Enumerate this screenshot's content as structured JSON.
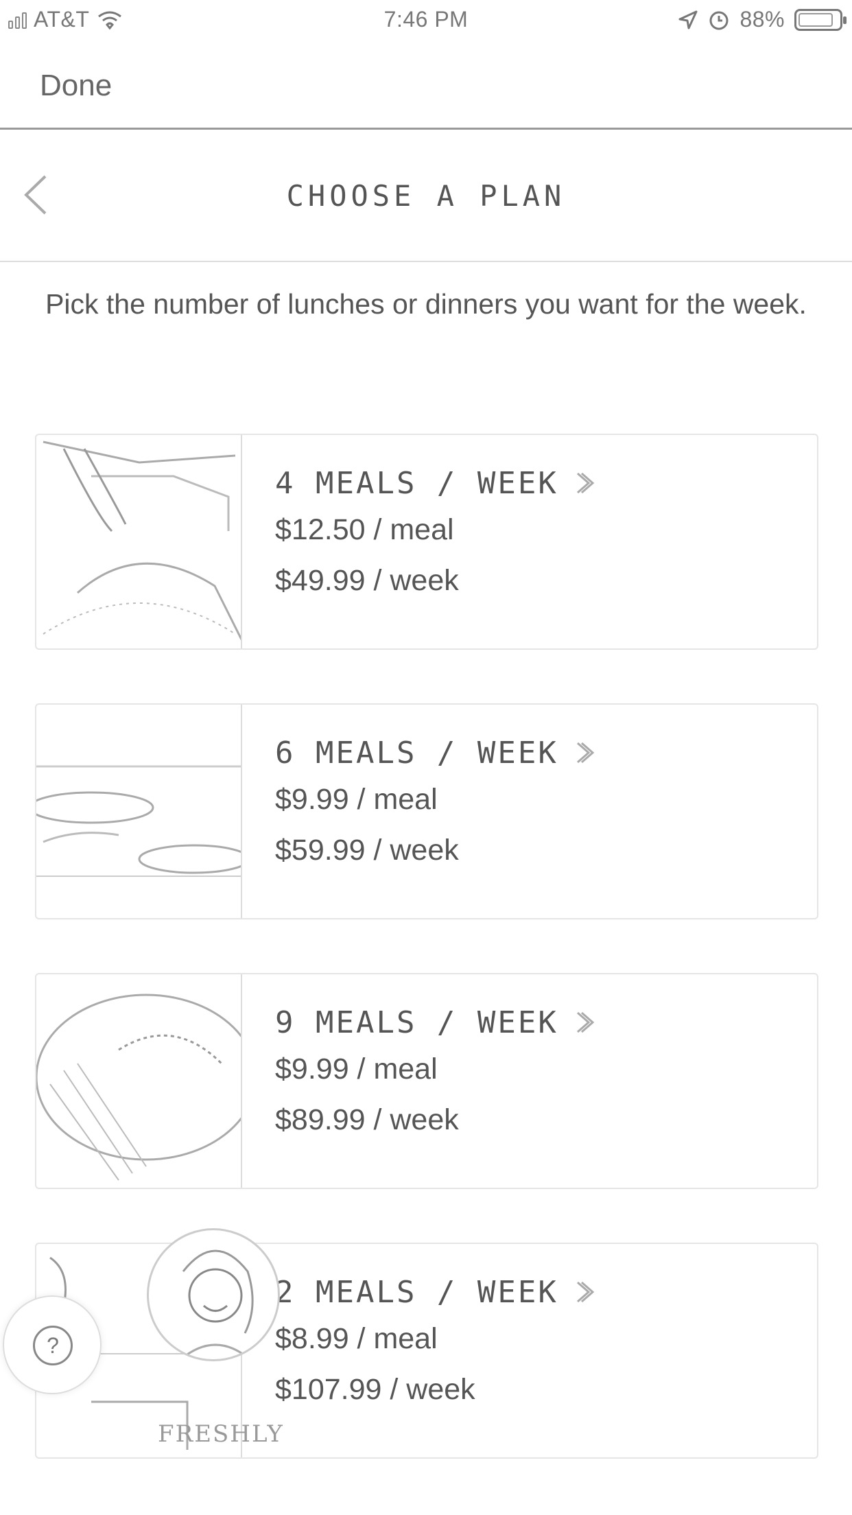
{
  "status_bar": {
    "carrier": "AT&T",
    "time": "7:46 PM",
    "battery": "88%"
  },
  "toolbar": {
    "done_label": "Done"
  },
  "header": {
    "title": "CHOOSE A PLAN"
  },
  "intro": "Pick the number of lunches or dinners you want for the week.",
  "plans": [
    {
      "title": "4 MEALS / WEEK",
      "per_meal": "$12.50 / meal",
      "per_week": "$49.99 / week"
    },
    {
      "title": "6 MEALS / WEEK",
      "per_meal": "$9.99 / meal",
      "per_week": "$59.99 / week"
    },
    {
      "title": "9 MEALS / WEEK",
      "per_meal": "$9.99 / meal",
      "per_week": "$89.99 / week"
    },
    {
      "title": "2 MEALS / WEEK",
      "per_meal": "$8.99 / meal",
      "per_week": "$107.99 / week"
    }
  ],
  "help": {
    "icon": "?"
  },
  "brand": "FRESHLY"
}
